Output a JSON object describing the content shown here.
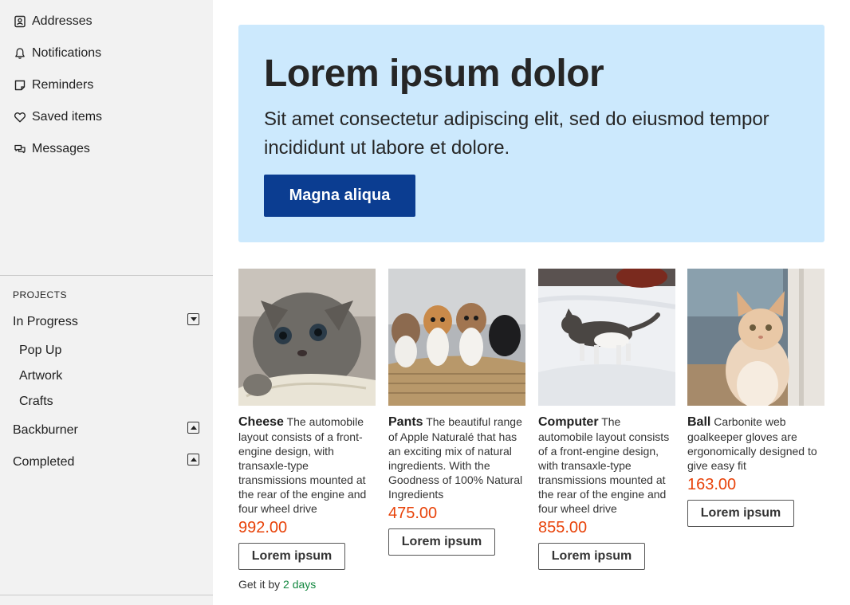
{
  "sidebar": {
    "nav": [
      {
        "label": "Addresses",
        "icon": "contact-card-icon"
      },
      {
        "label": "Notifications",
        "icon": "bell-icon"
      },
      {
        "label": "Reminders",
        "icon": "note-icon"
      },
      {
        "label": "Saved items",
        "icon": "heart-icon"
      },
      {
        "label": "Messages",
        "icon": "chat-bubbles-icon"
      }
    ],
    "projects": {
      "title": "PROJECTS",
      "groups": [
        {
          "label": "In Progress",
          "expanded": true,
          "children": [
            "Pop Up",
            "Artwork",
            "Crafts"
          ]
        },
        {
          "label": "Backburner",
          "expanded": false
        },
        {
          "label": "Completed",
          "expanded": false
        }
      ]
    }
  },
  "hero": {
    "title": "Lorem ipsum dolor",
    "text": "Sit amet consectetur adipiscing elit, sed do eiusmod tempor incididunt ut labore et dolore.",
    "button": "Magna aliqua"
  },
  "products": [
    {
      "name": "Cheese",
      "description": "The automobile layout consists of a front-engine design, with transaxle-type transmissions mounted at the rear of the engine and four wheel drive",
      "price": "992.00",
      "button": "Lorem ipsum",
      "shipping_prefix": "Get it by",
      "shipping_days": "2 days",
      "image": "gray tabby kitten on knitted blanket"
    },
    {
      "name": "Pants",
      "description": "The beautiful range of Apple Naturalé that has an exciting mix of natural ingredients. With the Goodness of 100% Natural Ingredients",
      "price": "475.00",
      "button": "Lorem ipsum",
      "image": "four kittens in a wicker basket"
    },
    {
      "name": "Computer",
      "description": "The automobile layout consists of a front-engine design, with transaxle-type transmissions mounted at the rear of the engine and four wheel drive",
      "price": "855.00",
      "button": "Lorem ipsum",
      "image": "cat walking in snow"
    },
    {
      "name": "Ball",
      "description": "Carbonite web goalkeeper gloves are ergonomically designed to give easy fit",
      "price": "163.00",
      "button": "Lorem ipsum",
      "image": "orange and white cat by a post"
    }
  ],
  "colors": {
    "sidebar_bg": "#f2f2f2",
    "hero_bg": "#cce9fd",
    "primary_button": "#0b3d91",
    "price": "#e8430a",
    "shipping_days": "#12873f"
  }
}
